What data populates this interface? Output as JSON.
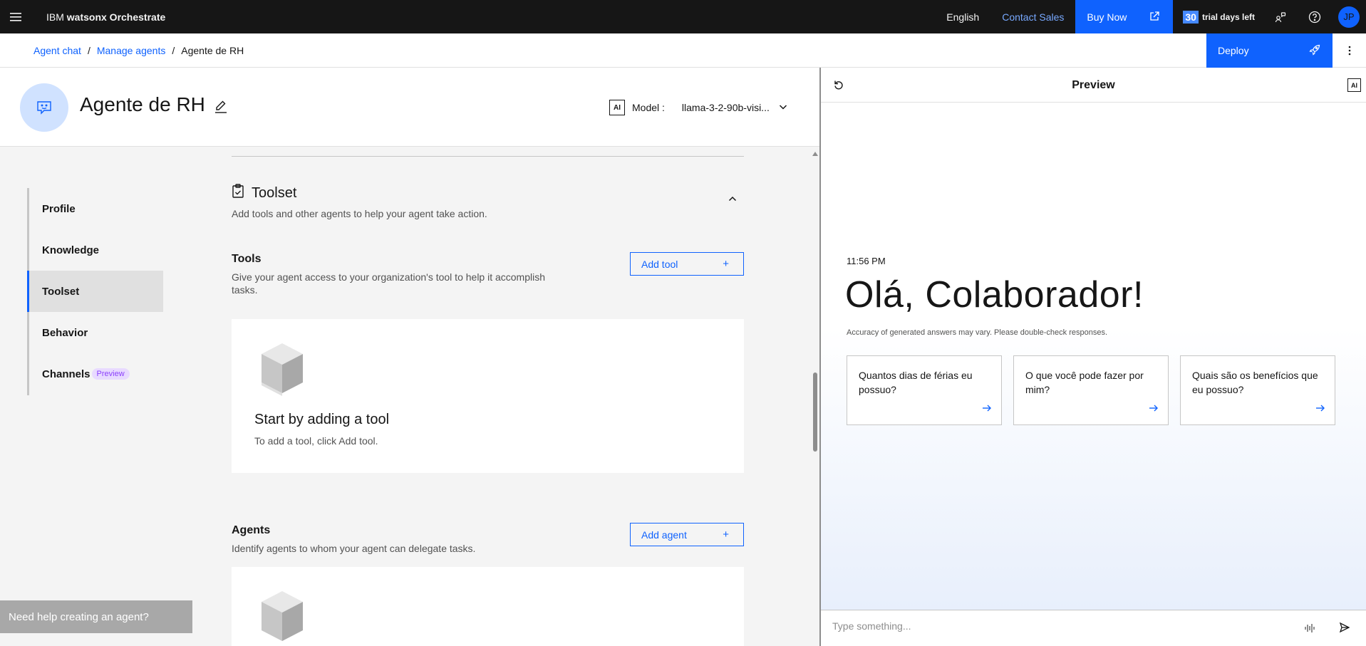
{
  "topbar": {
    "menu_icon": "hamburger-menu-icon",
    "brand_prefix": "IBM ",
    "brand_name": "watsonx Orchestrate",
    "language": "English",
    "contact_sales": "Contact Sales",
    "buy_now": "Buy Now",
    "trial_days": "30",
    "trial_label": "trial days left",
    "avatar_initials": "JP"
  },
  "breadcrumb": {
    "items": [
      "Agent chat",
      "Manage agents",
      "Agente de RH"
    ],
    "separator": "/"
  },
  "deploy_label": "Deploy",
  "agent": {
    "name": "Agente de RH",
    "model_badge": "AI",
    "model_label": "Model :",
    "model_value": "llama-3-2-90b-visi..."
  },
  "sidenav": {
    "items": [
      {
        "label": "Profile"
      },
      {
        "label": "Knowledge"
      },
      {
        "label": "Toolset"
      },
      {
        "label": "Behavior"
      },
      {
        "label": "Channels",
        "tag": "Preview"
      }
    ],
    "active": "Toolset"
  },
  "toolset": {
    "title": "Toolset",
    "description": "Add tools and other agents to help your agent take action.",
    "tools": {
      "title": "Tools",
      "description": "Give your agent access to your organization's tool to help it accomplish tasks.",
      "add_button": "Add tool",
      "empty_title": "Start by adding a tool",
      "empty_desc": "To add a tool, click Add tool."
    },
    "agents": {
      "title": "Agents",
      "description": "Identify agents to whom your agent can delegate tasks.",
      "add_button": "Add agent"
    }
  },
  "help_box": "Need help creating an agent?",
  "preview": {
    "title": "Preview",
    "ai_badge": "AI",
    "time": "11:56 PM",
    "greeting": "Olá, Colaborador!",
    "disclaimer": "Accuracy of generated answers may vary. Please double-check responses.",
    "suggestions": [
      "Quantos dias de férias eu possuo?",
      "O que você pode fazer por mim?",
      "Quais são os benefícios que eu possuo?"
    ],
    "input_placeholder": "Type something..."
  },
  "colors": {
    "accent": "#0f62fe",
    "topbar_bg": "#161616",
    "preview_tag": "#8a3ffc"
  }
}
